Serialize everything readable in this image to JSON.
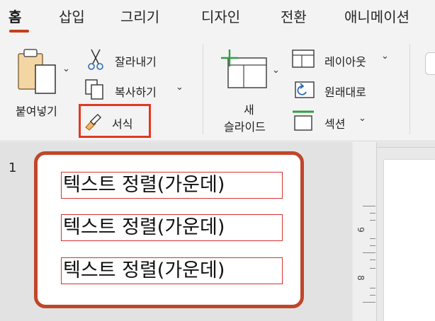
{
  "tabs": [
    "홈",
    "삽입",
    "그리기",
    "디자인",
    "전환",
    "애니메이션"
  ],
  "ribbon": {
    "paste_label": "붙여넣기",
    "cut_label": "잘라내기",
    "copy_label": "복사하기",
    "format_painter_label": "서식",
    "new_slide_label_line1": "새",
    "new_slide_label_line2": "슬라이드",
    "layout_label": "레이아웃",
    "reset_label": "원래대로",
    "section_label": "섹션"
  },
  "slides": [
    {
      "number": "1",
      "textboxes": [
        "텍스트 정렬(가운데)",
        "텍스트 정렬(가운데)",
        "텍스트 정렬(가운데)"
      ]
    }
  ],
  "ruler": {
    "labels": [
      "9",
      "8"
    ]
  },
  "colors": {
    "accent": "#c43e1c",
    "highlight": "#e03a22",
    "slide_border": "#c0462a",
    "textbox_border": "#d83131"
  }
}
